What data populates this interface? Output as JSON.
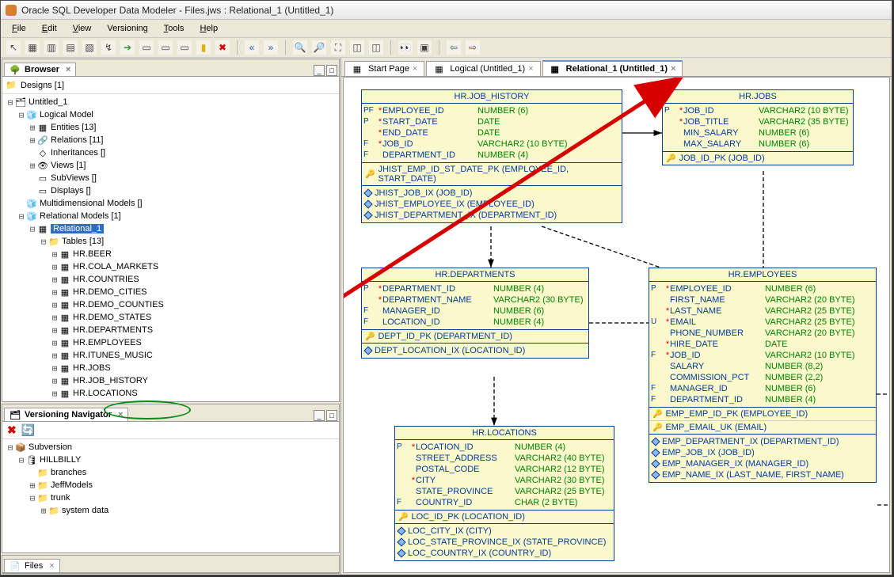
{
  "window": {
    "title": "Oracle SQL Developer Data Modeler - Files.jws : Relational_1 (Untitled_1)"
  },
  "menu": [
    "File",
    "Edit",
    "View",
    "Versioning",
    "Tools",
    "Help"
  ],
  "tabs_left": {
    "browser": "Browser",
    "designs": "Designs [1]",
    "versioning": "Versioning Navigator",
    "files": "Files"
  },
  "doc_tabs": [
    {
      "label": "Start Page",
      "sel": false
    },
    {
      "label": "Logical (Untitled_1)",
      "sel": false
    },
    {
      "label": "Relational_1 (Untitled_1)",
      "sel": true
    }
  ],
  "tree": {
    "root": "Untitled_1",
    "logical": "Logical Model",
    "logical_children": [
      "Entities [13]",
      "Relations [11]",
      "Inheritances []",
      "Views [1]",
      "SubViews []",
      "Displays []"
    ],
    "multi": "Multidimensional Models []",
    "relmodels": "Relational Models [1]",
    "rel1": "Relational_1",
    "tables_label": "Tables [13]",
    "tables": [
      "HR.BEER",
      "HR.COLA_MARKETS",
      "HR.COUNTRIES",
      "HR.DEMO_CITIES",
      "HR.DEMO_COUNTIES",
      "HR.DEMO_STATES",
      "HR.DEPARTMENTS",
      "HR.EMPLOYEES",
      "HR.ITUNES_MUSIC",
      "HR.JOBS",
      "HR.JOB_HISTORY",
      "HR.LOCATIONS"
    ]
  },
  "version_tree": {
    "root": "Subversion",
    "conn": "HILLBILLY",
    "children": [
      "branches",
      "JeffModels",
      "trunk",
      "system data"
    ]
  },
  "entities": {
    "job_history": {
      "title": "HR.JOB_HISTORY",
      "cols": [
        {
          "flag": "PF",
          "star": "*",
          "name": "EMPLOYEE_ID",
          "type": "NUMBER (6)"
        },
        {
          "flag": "P",
          "star": "*",
          "name": "START_DATE",
          "type": "DATE"
        },
        {
          "flag": "",
          "star": "*",
          "name": "END_DATE",
          "type": "DATE"
        },
        {
          "flag": "F",
          "star": "*",
          "name": "JOB_ID",
          "type": "VARCHAR2 (10 BYTE)"
        },
        {
          "flag": "F",
          "star": "",
          "name": "DEPARTMENT_ID",
          "type": "NUMBER (4)"
        }
      ],
      "pk": "JHIST_EMP_ID_ST_DATE_PK (EMPLOYEE_ID, START_DATE)",
      "idx": [
        "JHIST_JOB_IX (JOB_ID)",
        "JHIST_EMPLOYEE_IX (EMPLOYEE_ID)",
        "JHIST_DEPARTMENT_IX (DEPARTMENT_ID)"
      ]
    },
    "jobs": {
      "title": "HR.JOBS",
      "cols": [
        {
          "flag": "P",
          "star": "*",
          "name": "JOB_ID",
          "type": "VARCHAR2 (10 BYTE)"
        },
        {
          "flag": "",
          "star": "*",
          "name": "JOB_TITLE",
          "type": "VARCHAR2 (35 BYTE)"
        },
        {
          "flag": "",
          "star": "",
          "name": "MIN_SALARY",
          "type": "NUMBER (6)"
        },
        {
          "flag": "",
          "star": "",
          "name": "MAX_SALARY",
          "type": "NUMBER (6)"
        }
      ],
      "pk": "JOB_ID_PK (JOB_ID)"
    },
    "departments": {
      "title": "HR.DEPARTMENTS",
      "cols": [
        {
          "flag": "P",
          "star": "*",
          "name": "DEPARTMENT_ID",
          "type": "NUMBER (4)"
        },
        {
          "flag": "",
          "star": "*",
          "name": "DEPARTMENT_NAME",
          "type": "VARCHAR2 (30 BYTE)"
        },
        {
          "flag": "F",
          "star": "",
          "name": "MANAGER_ID",
          "type": "NUMBER (6)"
        },
        {
          "flag": "F",
          "star": "",
          "name": "LOCATION_ID",
          "type": "NUMBER (4)"
        }
      ],
      "pk": "DEPT_ID_PK (DEPARTMENT_ID)",
      "idx": [
        "DEPT_LOCATION_IX (LOCATION_ID)"
      ]
    },
    "employees": {
      "title": "HR.EMPLOYEES",
      "cols": [
        {
          "flag": "P",
          "star": "*",
          "name": "EMPLOYEE_ID",
          "type": "NUMBER (6)"
        },
        {
          "flag": "",
          "star": "",
          "name": "FIRST_NAME",
          "type": "VARCHAR2 (20 BYTE)"
        },
        {
          "flag": "",
          "star": "*",
          "name": "LAST_NAME",
          "type": "VARCHAR2 (25 BYTE)"
        },
        {
          "flag": "U",
          "star": "*",
          "name": "EMAIL",
          "type": "VARCHAR2 (25 BYTE)"
        },
        {
          "flag": "",
          "star": "",
          "name": "PHONE_NUMBER",
          "type": "VARCHAR2 (20 BYTE)"
        },
        {
          "flag": "",
          "star": "*",
          "name": "HIRE_DATE",
          "type": "DATE"
        },
        {
          "flag": "F",
          "star": "*",
          "name": "JOB_ID",
          "type": "VARCHAR2 (10 BYTE)"
        },
        {
          "flag": "",
          "star": "",
          "name": "SALARY",
          "type": "NUMBER (8,2)"
        },
        {
          "flag": "",
          "star": "",
          "name": "COMMISSION_PCT",
          "type": "NUMBER (2,2)"
        },
        {
          "flag": "F",
          "star": "",
          "name": "MANAGER_ID",
          "type": "NUMBER (6)"
        },
        {
          "flag": "F",
          "star": "",
          "name": "DEPARTMENT_ID",
          "type": "NUMBER (4)"
        }
      ],
      "pk": "EMP_EMP_ID_PK (EMPLOYEE_ID)",
      "uk": "EMP_EMAIL_UK (EMAIL)",
      "idx": [
        "EMP_DEPARTMENT_IX (DEPARTMENT_ID)",
        "EMP_JOB_IX (JOB_ID)",
        "EMP_MANAGER_IX (MANAGER_ID)",
        "EMP_NAME_IX (LAST_NAME, FIRST_NAME)"
      ]
    },
    "locations": {
      "title": "HR.LOCATIONS",
      "cols": [
        {
          "flag": "P",
          "star": "*",
          "name": "LOCATION_ID",
          "type": "NUMBER (4)"
        },
        {
          "flag": "",
          "star": "",
          "name": "STREET_ADDRESS",
          "type": "VARCHAR2 (40 BYTE)"
        },
        {
          "flag": "",
          "star": "",
          "name": "POSTAL_CODE",
          "type": "VARCHAR2 (12 BYTE)"
        },
        {
          "flag": "",
          "star": "*",
          "name": "CITY",
          "type": "VARCHAR2 (30 BYTE)"
        },
        {
          "flag": "",
          "star": "",
          "name": "STATE_PROVINCE",
          "type": "VARCHAR2 (25 BYTE)"
        },
        {
          "flag": "F",
          "star": "",
          "name": "COUNTRY_ID",
          "type": "CHAR (2 BYTE)"
        }
      ],
      "pk": "LOC_ID_PK (LOCATION_ID)",
      "idx": [
        "LOC_CITY_IX (CITY)",
        "LOC_STATE_PROVINCE_IX (STATE_PROVINCE)",
        "LOC_COUNTRY_IX (COUNTRY_ID)"
      ]
    }
  }
}
